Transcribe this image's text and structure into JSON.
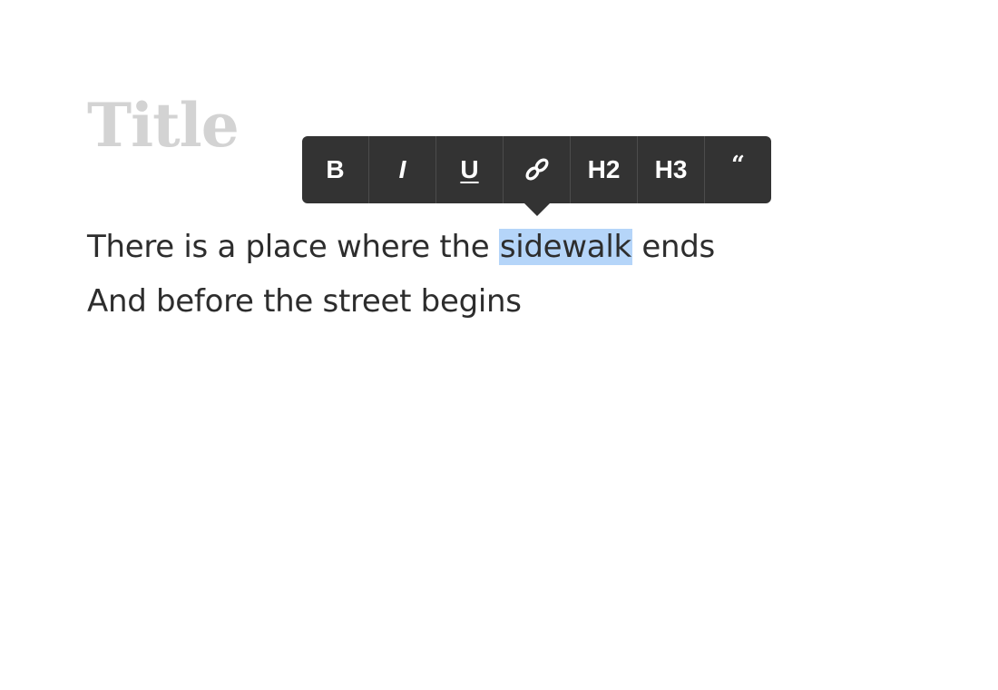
{
  "editor": {
    "title_placeholder": "Title",
    "lines": {
      "line1_before": "There is a place where the ",
      "line1_selected": "sidewalk",
      "line1_after": " ends",
      "line2": "And before the street begins"
    },
    "selection_color": "#b5d5f9"
  },
  "toolbar": {
    "bold_label": "B",
    "italic_label": "I",
    "underline_label": "U",
    "link_icon": "link-icon",
    "h2_label": "H2",
    "h3_label": "H3",
    "quote_label": "“",
    "background_color": "#333333"
  }
}
